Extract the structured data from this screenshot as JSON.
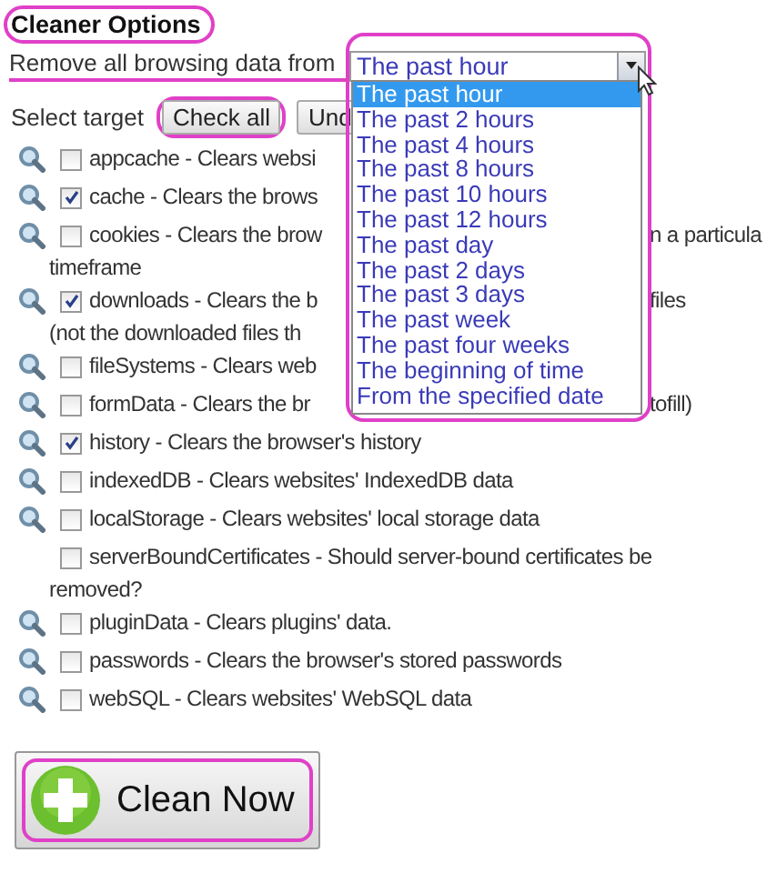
{
  "title": "Cleaner Options",
  "range": {
    "label": "Remove all browsing data from",
    "value": "The past hour",
    "options": [
      {
        "label": "The past hour",
        "selected": true
      },
      {
        "label": "The past 2 hours",
        "selected": false
      },
      {
        "label": "The past 4 hours",
        "selected": false
      },
      {
        "label": "The past 8 hours",
        "selected": false
      },
      {
        "label": "The past 10 hours",
        "selected": false
      },
      {
        "label": "The past 12 hours",
        "selected": false
      },
      {
        "label": "The past day",
        "selected": false
      },
      {
        "label": "The past 2 days",
        "selected": false
      },
      {
        "label": "The past 3 days",
        "selected": false
      },
      {
        "label": "The past week",
        "selected": false
      },
      {
        "label": "The past four weeks",
        "selected": false
      },
      {
        "label": "The beginning of time",
        "selected": false
      },
      {
        "label": "From the specified date",
        "selected": false
      }
    ]
  },
  "select_target": {
    "label": "Select target",
    "buttons": [
      "Check all",
      "Und"
    ]
  },
  "targets": [
    {
      "has_search": true,
      "checked": false,
      "lines": [
        {
          "left": "appcache - Clears websi"
        }
      ]
    },
    {
      "has_search": true,
      "checked": true,
      "lines": [
        {
          "left": "cache - Clears the brows"
        }
      ]
    },
    {
      "has_search": true,
      "checked": false,
      "lines": [
        {
          "left": "cookies - Clears the brow",
          "right": "n a particula"
        },
        {
          "left": "timeframe"
        }
      ]
    },
    {
      "has_search": true,
      "checked": true,
      "lines": [
        {
          "left": "downloads - Clears the b",
          "right": "files"
        },
        {
          "left": "(not the downloaded files th"
        }
      ]
    },
    {
      "has_search": true,
      "checked": false,
      "lines": [
        {
          "left": "fileSystems - Clears web"
        }
      ]
    },
    {
      "has_search": true,
      "checked": false,
      "lines": [
        {
          "left": "formData - Clears the br",
          "right": "tofill)"
        }
      ]
    },
    {
      "has_search": true,
      "checked": true,
      "lines": [
        {
          "left": "history - Clears the browser's history"
        }
      ]
    },
    {
      "has_search": true,
      "checked": false,
      "lines": [
        {
          "left": "indexedDB - Clears websites' IndexedDB data"
        }
      ]
    },
    {
      "has_search": true,
      "checked": false,
      "lines": [
        {
          "left": "localStorage - Clears websites' local storage data"
        }
      ]
    },
    {
      "has_search": false,
      "checked": false,
      "lines": [
        {
          "left": "serverBoundCertificates - Should server-bound certificates be"
        },
        {
          "left": "removed?"
        }
      ]
    },
    {
      "has_search": true,
      "checked": false,
      "lines": [
        {
          "left": "pluginData - Clears plugins' data."
        }
      ]
    },
    {
      "has_search": true,
      "checked": false,
      "lines": [
        {
          "left": "passwords - Clears the browser's stored passwords"
        }
      ]
    },
    {
      "has_search": true,
      "checked": false,
      "lines": [
        {
          "left": "webSQL - Clears websites' WebSQL data"
        }
      ]
    }
  ],
  "clean_button": "Clean Now"
}
